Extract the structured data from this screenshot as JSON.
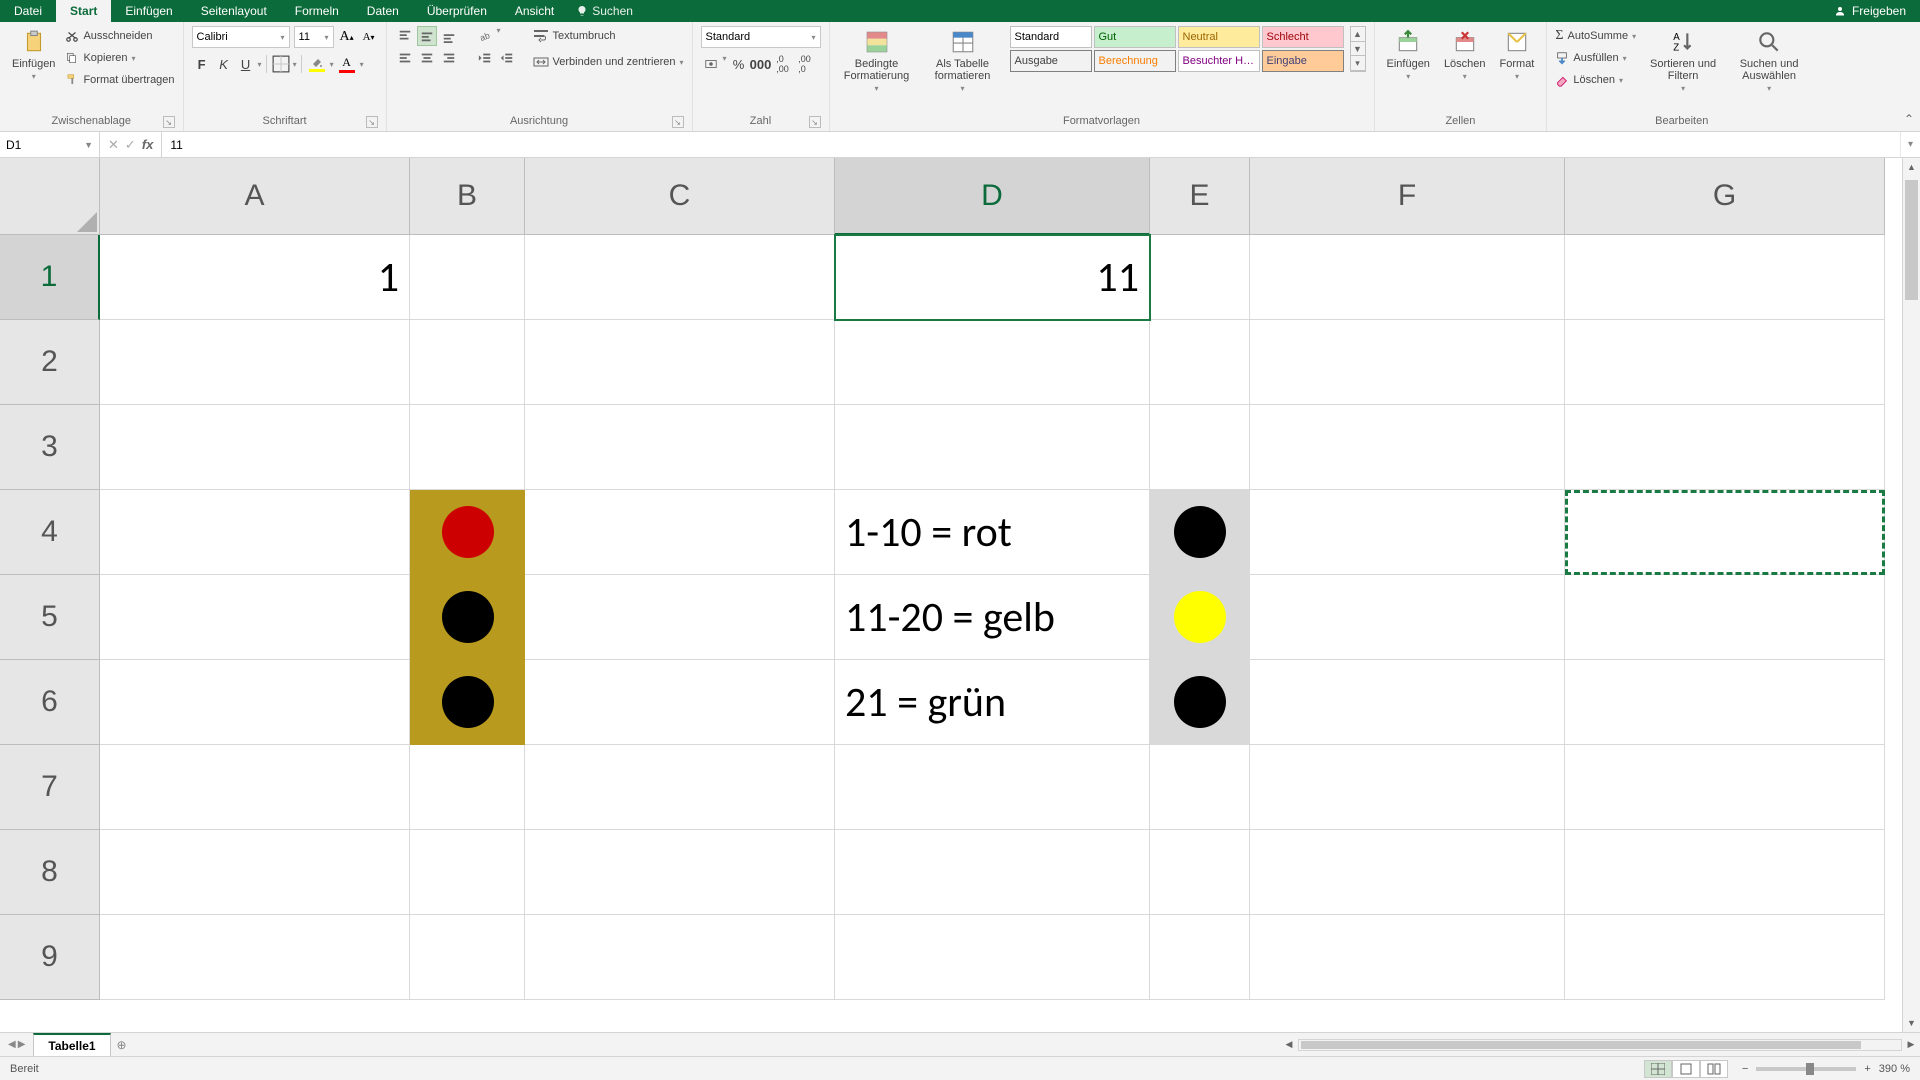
{
  "titlebar": {
    "tabs": [
      "Datei",
      "Start",
      "Einfügen",
      "Seitenlayout",
      "Formeln",
      "Daten",
      "Überprüfen",
      "Ansicht"
    ],
    "active_tab": "Start",
    "tellme_placeholder": "Suchen",
    "share_label": "Freigeben"
  },
  "ribbon": {
    "clipboard": {
      "paste": "Einfügen",
      "cut": "Ausschneiden",
      "copy": "Kopieren",
      "format_painter": "Format übertragen",
      "group_label": "Zwischenablage"
    },
    "font": {
      "font_name": "Calibri",
      "font_size": "11",
      "group_label": "Schriftart"
    },
    "alignment": {
      "wrap": "Textumbruch",
      "merge": "Verbinden und zentrieren",
      "group_label": "Ausrichtung"
    },
    "number": {
      "format": "Standard",
      "group_label": "Zahl"
    },
    "styles": {
      "cond_format": "Bedingte Formatierung",
      "as_table": "Als Tabelle formatieren",
      "cells": [
        {
          "text": "Standard",
          "bg": "#ffffff",
          "fg": "#000000",
          "border": "#c0c0c0"
        },
        {
          "text": "Gut",
          "bg": "#c6efce",
          "fg": "#006100",
          "border": "#c0c0c0"
        },
        {
          "text": "Neutral",
          "bg": "#ffeb9c",
          "fg": "#9c6500",
          "border": "#c0c0c0"
        },
        {
          "text": "Schlecht",
          "bg": "#ffc7ce",
          "fg": "#9c0006",
          "border": "#c0c0c0"
        },
        {
          "text": "Ausgabe",
          "bg": "#f2f2f2",
          "fg": "#3f3f3f",
          "border": "#808080"
        },
        {
          "text": "Berechnung",
          "bg": "#f2f2f2",
          "fg": "#fa7d00",
          "border": "#808080"
        },
        {
          "text": "Besuchter H…",
          "bg": "#ffffff",
          "fg": "#800080",
          "border": "#c0c0c0"
        },
        {
          "text": "Eingabe",
          "bg": "#ffcc99",
          "fg": "#3f3f76",
          "border": "#808080"
        }
      ],
      "group_label": "Formatvorlagen"
    },
    "cells_group": {
      "insert": "Einfügen",
      "delete": "Löschen",
      "format": "Format",
      "group_label": "Zellen"
    },
    "editing": {
      "autosum": "AutoSumme",
      "fill": "Ausfüllen",
      "clear": "Löschen",
      "sort": "Sortieren und Filtern",
      "find": "Suchen und Auswählen",
      "group_label": "Bearbeiten"
    }
  },
  "fxbar": {
    "namebox": "D1",
    "formula": "11"
  },
  "grid": {
    "columns": [
      "A",
      "B",
      "C",
      "D",
      "E",
      "F",
      "G"
    ],
    "row_count": 9,
    "selected_cell": "D1",
    "copied_range": "G4",
    "cells": {
      "A1": "1",
      "D1": "11",
      "D4": "1-10 = rot",
      "D5": "11-20 = gelb",
      "D6": "21 = grün"
    },
    "traffic_light_b": {
      "top": "#cc0000",
      "mid": "#000000",
      "bot": "#000000"
    },
    "traffic_light_e": {
      "top": "#000000",
      "mid": "#ffff00",
      "bot": "#000000"
    }
  },
  "sheets": {
    "active": "Tabelle1"
  },
  "status": {
    "ready": "Bereit",
    "zoom": "390 %"
  }
}
